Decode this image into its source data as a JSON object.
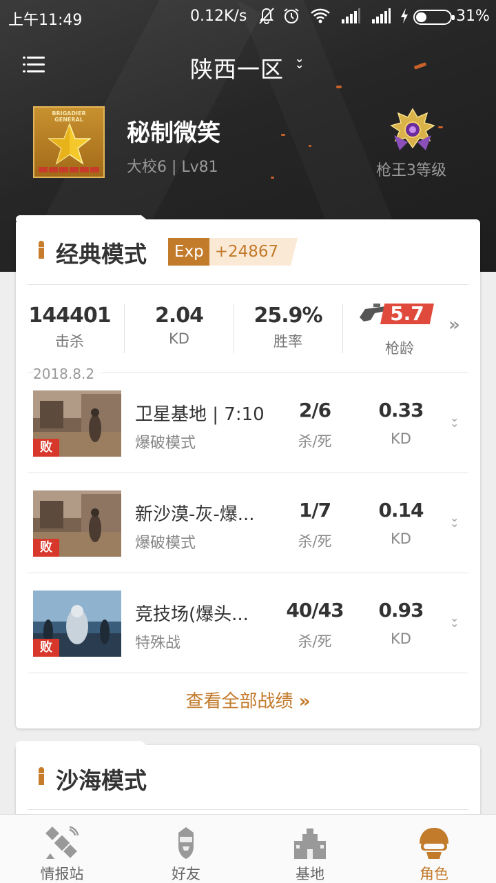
{
  "status_bar": {
    "time": "上午11:49",
    "net_speed": "0.12K/s",
    "battery": "31%",
    "icons": [
      "mute-icon",
      "alarm-icon",
      "wifi-icon",
      "signal-icon",
      "signal-icon",
      "charging-icon",
      "battery-icon"
    ]
  },
  "header": {
    "server": "陕西一区",
    "player_name": "秘制微笑",
    "player_level": "大校6 | Lv81",
    "rank_badge_text_1": "BRIGADIER",
    "rank_badge_text_2": "GENERAL",
    "gun_rank": "枪王3等级"
  },
  "classic": {
    "title": "经典模式",
    "exp_label": "Exp",
    "exp_value": "+24867",
    "stats": {
      "kills": "144401",
      "kills_label": "击杀",
      "kd": "2.04",
      "kd_label": "KD",
      "win_rate": "25.9%",
      "win_rate_label": "胜率",
      "gun_age": "5.7",
      "gun_age_label": "枪龄"
    },
    "date": "2018.8.2",
    "matches": [
      {
        "map": "卫星基地 | 7:10",
        "mode": "爆破模式",
        "result": "败",
        "kd_ratio": "2/6",
        "kd_ratio_label": "杀/死",
        "kd": "0.33",
        "kd_label": "KD"
      },
      {
        "map": "新沙漠-灰-爆...",
        "mode": "爆破模式",
        "result": "败",
        "kd_ratio": "1/7",
        "kd_ratio_label": "杀/死",
        "kd": "0.14",
        "kd_label": "KD"
      },
      {
        "map": "竞技场(爆头...",
        "mode": "特殊战",
        "result": "败",
        "kd_ratio": "40/43",
        "kd_ratio_label": "杀/死",
        "kd": "0.93",
        "kd_label": "KD"
      }
    ],
    "view_all": "查看全部战绩"
  },
  "sand": {
    "title": "沙海模式"
  },
  "bottom_nav": [
    {
      "label": "情报站",
      "icon": "satellite-icon",
      "active": false
    },
    {
      "label": "好友",
      "icon": "soldier-icon",
      "active": false
    },
    {
      "label": "基地",
      "icon": "castle-icon",
      "active": false
    },
    {
      "label": "角色",
      "icon": "helmet-icon",
      "active": true
    }
  ],
  "colors": {
    "accent": "#c27a2b",
    "lose": "#d8382b",
    "header_bg": "#262626"
  }
}
